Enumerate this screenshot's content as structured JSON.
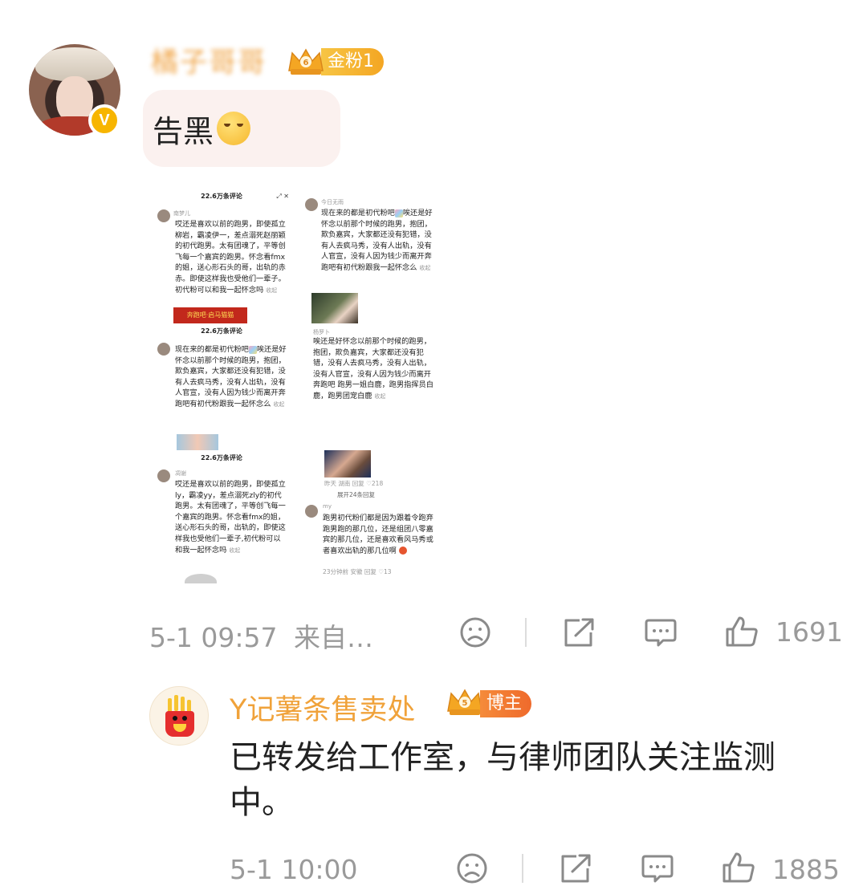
{
  "comment": {
    "username": "橘子哥哥",
    "fan_badge": {
      "level": "6",
      "label": "金粉1"
    },
    "verified_badge": "V",
    "text": "告黑",
    "time": "5-1 09:57",
    "source": "来自…",
    "like_count": "1691"
  },
  "collage": {
    "p1": {
      "header": "22.6万条评论",
      "user": "南梦儿",
      "text": "哎还是喜欢以前的跑男，即使孤立柳岩，霸凌伊一，差点溺死赵丽颖的初代跑男。太有团魂了，平等创飞每一个嘉宾的跑男。怀念看fmx的姐，送心形石头的哥，出轨的赤赤。即使这样我也受他们一辈子。初代粉可以和我一起怀念吗",
      "fold": "收起",
      "banner": "奔跑吧·启马猫猫"
    },
    "p2": {
      "user": "今日无雨",
      "text_a": "现在来的都是初代粉吧",
      "text_b": "唉还是好怀念以前那个时候的跑男，抱团，欺负嘉宾，大家都还没有犯错，没有人去疯马秀，没有人出轨，没有人官宣，没有人因为钱少而离开奔跑吧有初代粉跟我一起怀念么",
      "fold": "收起"
    },
    "p3": {
      "header": "22.6万条评论",
      "text_a": "现在来的都是初代粉吧",
      "text_b": "唉还是好怀念以前那个时候的跑男，抱团，欺负嘉宾，大家都还没有犯错，没有人去疯马秀，没有人出轨，没有人官宣，没有人因为钱少而离开奔跑吧有初代粉跟我一起怀念么",
      "fold": "收起"
    },
    "p4": {
      "user": "杨罗卜",
      "text": "唉还是好怀念以前那个时候的跑男，抱团，欺负嘉宾，大家都还没有犯错，没有人去疯马秀，没有人出轨，没有人官宣，没有人因为钱少而离开奔跑吧 跑男一姐白鹿，跑男指挥员白鹿，跑男团宠白鹿",
      "fold": "收起",
      "meta_time": "昨天",
      "meta_loc": "湖南",
      "meta_reply": "回复",
      "meta_likes": "♡218",
      "expand": "展开24条回复"
    },
    "p5": {
      "header": "22.6万条评论",
      "user": "凋谢",
      "text": "哎还是喜欢以前的跑男，即使孤立ly，霸凌yy，差点溺死zly的初代跑男。太有团魂了，平等创飞每一个嘉宾的跑男。怀念看fmx的姐，送心形石头的哥，出轨的，即使这样我也受他们一辈子,初代粉可以和我一起怀念吗",
      "fold": "收起"
    },
    "p6": {
      "user": "my",
      "text": "跑男初代粉们都是因为跟着令跑弃跑男跑的那几位，还是组团八零嘉宾的那几位，还是喜欢看风马秀或者喜欢出轨的那几位啊",
      "meta_time": "23分钟前",
      "meta_loc": "安徽",
      "meta_reply": "回复",
      "meta_likes": "♡13"
    }
  },
  "reply": {
    "username": "Y记薯条售卖处",
    "badge": {
      "level": "5",
      "label": "博主"
    },
    "text": "已转发给工作室，与律师团队关注监测中。",
    "time": "5-1 10:00",
    "like_count": "1885"
  },
  "icons": {
    "dislike": "sad-face-icon",
    "share": "share-icon",
    "comment": "comment-icon",
    "like": "thumbs-up-icon"
  },
  "colors": {
    "username_gold": "#f0a64a",
    "fan_badge_gold": "#f4a623",
    "blogger_orange": "#ef6a2c",
    "meta_grey": "#9a9a9a",
    "bubble_bg": "#fbf1ef"
  }
}
